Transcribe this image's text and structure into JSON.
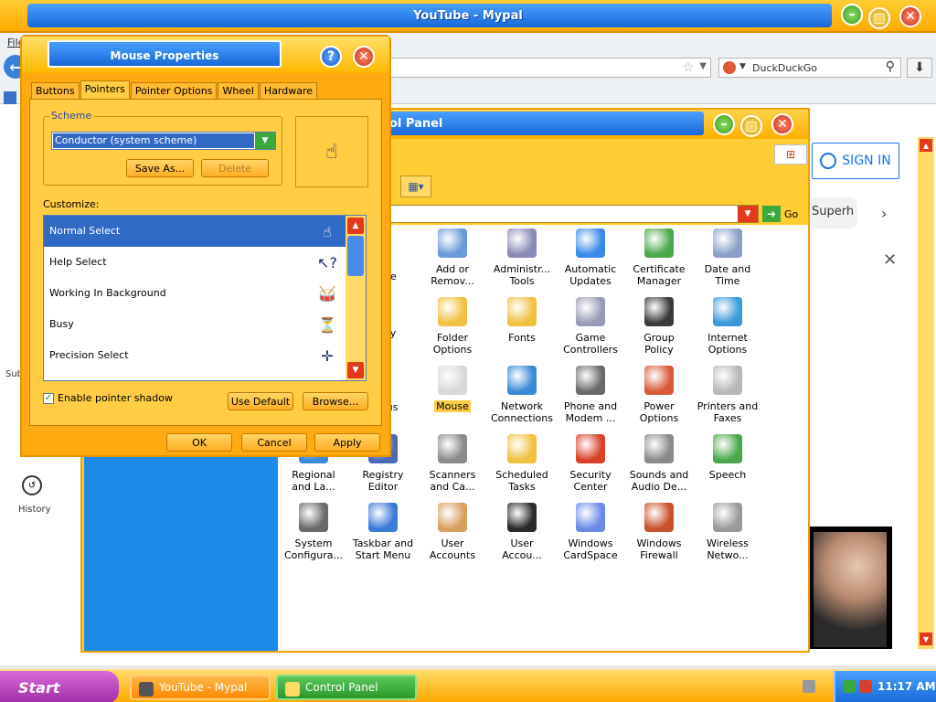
{
  "browser": {
    "title": "YouTube - Mypal",
    "menu_file": "File",
    "search_engine": "DuckDuckGo",
    "youtube": {
      "sign_in": "SIGN IN",
      "chip": "Superh",
      "subscriptions_partial": "Sub",
      "history": "History"
    }
  },
  "control_panel": {
    "title": "Control Panel",
    "title_visible": "ol Panel",
    "go_label": "Go",
    "icons": [
      {
        "label": "Add or\nRemov...",
        "icon": "add-remove-programs-icon",
        "color": "#6a9ad8"
      },
      {
        "label": "Administr...\nTools",
        "icon": "administrative-tools-icon",
        "color": "#8a8ab8"
      },
      {
        "label": "Automatic\nUpdates",
        "icon": "automatic-updates-icon",
        "color": "#3a8ae8"
      },
      {
        "label": "Certificate\nManager",
        "icon": "certificate-icon",
        "color": "#4aa84a"
      },
      {
        "label": "Date and\nTime",
        "icon": "clock-icon",
        "color": "#8aa0c8"
      },
      {
        "label": "Folder\nOptions",
        "icon": "folder-icon",
        "color": "#f0c040"
      },
      {
        "label": "Fonts",
        "icon": "fonts-folder-icon",
        "color": "#f0c040"
      },
      {
        "label": "Game\nControllers",
        "icon": "gamepad-icon",
        "color": "#9a9ab8"
      },
      {
        "label": "Group\nPolicy",
        "icon": "group-policy-icon",
        "color": "#3a3a3a"
      },
      {
        "label": "Internet\nOptions",
        "icon": "globe-icon",
        "color": "#3a9ad8"
      },
      {
        "label": "Mouse",
        "icon": "mouse-icon",
        "color": "#d8d8d8",
        "selected": true
      },
      {
        "label": "Network\nConnections",
        "icon": "network-icon",
        "color": "#3a8ad8"
      },
      {
        "label": "Phone and\nModem ...",
        "icon": "phone-icon",
        "color": "#6a6a6a"
      },
      {
        "label": "Power\nOptions",
        "icon": "power-icon",
        "color": "#d85a3a"
      },
      {
        "label": "Printers and\nFaxes",
        "icon": "printer-icon",
        "color": "#b8b8b8"
      },
      {
        "label": "Regional\nand La...",
        "icon": "regional-icon",
        "color": "#3a8ad8"
      },
      {
        "label": "Registry\nEditor",
        "icon": "registry-icon",
        "color": "#4a6ab8"
      },
      {
        "label": "Scanners\nand Ca...",
        "icon": "scanner-icon",
        "color": "#8a8a8a"
      },
      {
        "label": "Scheduled\nTasks",
        "icon": "scheduled-tasks-icon",
        "color": "#f0c040"
      },
      {
        "label": "Security\nCenter",
        "icon": "shield-icon",
        "color": "#d8402a"
      },
      {
        "label": "Sounds and\nAudio De...",
        "icon": "speaker-icon",
        "color": "#8a8a8a"
      },
      {
        "label": "Speech",
        "icon": "speech-icon",
        "color": "#4aa84a"
      },
      {
        "label": "System\nConfigura...",
        "icon": "system-config-icon",
        "color": "#6a6a6a"
      },
      {
        "label": "Taskbar and\nStart Menu",
        "icon": "taskbar-icon",
        "color": "#3a7ad8"
      },
      {
        "label": "User\nAccounts",
        "icon": "users-icon",
        "color": "#d8a060"
      },
      {
        "label": "User\nAccou...",
        "icon": "user-key-icon",
        "color": "#2a2a2a"
      },
      {
        "label": "Windows\nCardSpace",
        "icon": "cardspace-icon",
        "color": "#6a8ae8"
      },
      {
        "label": "Windows\nFirewall",
        "icon": "firewall-icon",
        "color": "#c8502a"
      },
      {
        "label": "Wireless\nNetwo...",
        "icon": "wireless-icon",
        "color": "#9a9a9a"
      }
    ],
    "partial_labels": [
      "are",
      "ay",
      "ous"
    ]
  },
  "mouse_properties": {
    "title": "Mouse Properties",
    "tabs": [
      "Buttons",
      "Pointers",
      "Pointer Options",
      "Wheel",
      "Hardware"
    ],
    "active_tab": "Pointers",
    "scheme_label": "Scheme",
    "scheme_value": "Conductor (system scheme)",
    "save_as": "Save As...",
    "delete": "Delete",
    "customize_label": "Customize:",
    "cursors": [
      {
        "label": "Normal Select",
        "icon": "hand-pointer-icon",
        "glyph": "☝",
        "selected": true
      },
      {
        "label": "Help Select",
        "icon": "help-cursor-icon",
        "glyph": "↖?"
      },
      {
        "label": "Working In Background",
        "icon": "drum-icon",
        "glyph": "🥁"
      },
      {
        "label": "Busy",
        "icon": "metronome-icon",
        "glyph": "⏳"
      },
      {
        "label": "Precision Select",
        "icon": "precision-hand-icon",
        "glyph": "✛"
      }
    ],
    "shadow_label": "Enable pointer shadow",
    "shadow_checked": true,
    "use_default": "Use Default",
    "browse": "Browse...",
    "ok": "OK",
    "cancel": "Cancel",
    "apply": "Apply"
  },
  "taskbar": {
    "start": "Start",
    "tasks": [
      {
        "label": "YouTube - Mypal",
        "color": "#ff9a1a"
      },
      {
        "label": "Control Panel",
        "color": "#3aa83a"
      }
    ],
    "clock": "11:17 AM"
  }
}
